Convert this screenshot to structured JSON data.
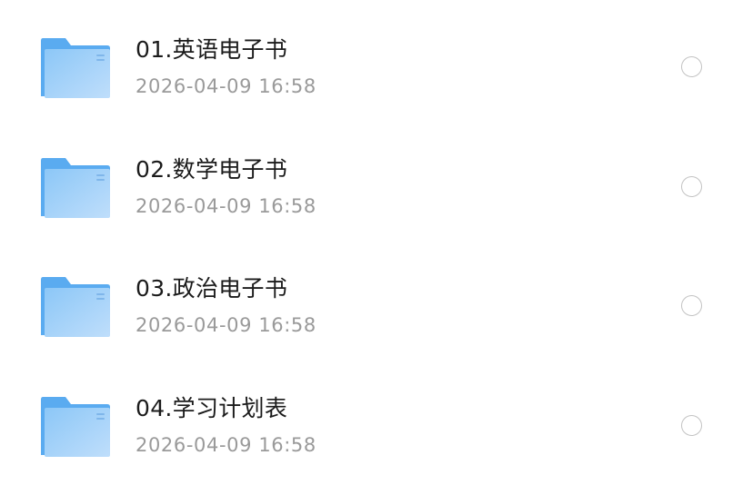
{
  "files": [
    {
      "name": "01.英语电子书",
      "date": "2026-04-09 16:58",
      "icon": "folder-icon"
    },
    {
      "name": "02.数学电子书",
      "date": "2026-04-09 16:58",
      "icon": "folder-icon"
    },
    {
      "name": "03.政治电子书",
      "date": "2026-04-09 16:58",
      "icon": "folder-icon"
    },
    {
      "name": "04.学习计划表",
      "date": "2026-04-09 16:58",
      "icon": "folder-icon"
    }
  ],
  "colors": {
    "folder_back": "#5aabf0",
    "folder_front_top": "#8cc7f7",
    "folder_front_bottom": "#bfdefb",
    "radio_border": "#c3c3c3",
    "name_text": "#1b1b1b",
    "date_text": "#9a9a9a"
  }
}
